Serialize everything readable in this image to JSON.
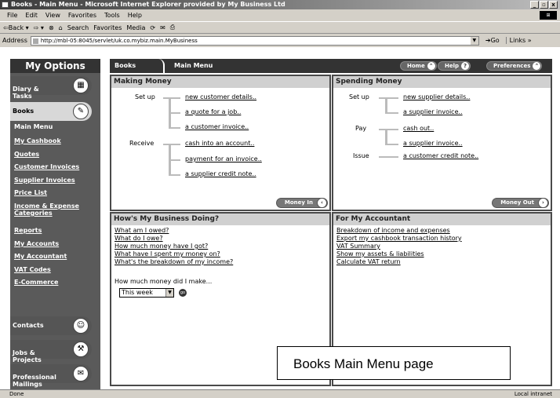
{
  "browser": {
    "title": "Books - Main Menu - Microsoft Internet Explorer provided by My Business Ltd",
    "menu": [
      "File",
      "Edit",
      "View",
      "Favorites",
      "Tools",
      "Help"
    ],
    "toolbar": [
      "⇦Back ▾",
      "⇨ ▾",
      "⊗",
      "⌂",
      "Search",
      "Favorites",
      "Media",
      "",
      "",
      ""
    ],
    "address_label": "Address",
    "address_value": "http://mbl-05:8045/servlet/uk.co.mybiz.main.MyBusiness",
    "go_label": "Go",
    "links_label": "Links",
    "status_left": "Done",
    "status_right": "Local intranet"
  },
  "sidebar": {
    "header": "My Options",
    "diary_label": "Diary &\nTasks",
    "books_label": "Books",
    "main_menu_label": "Main Menu",
    "links": [
      "My Cashbook",
      "Quotes",
      "Customer Invoices",
      "Supplier Invoices",
      "Price List",
      "Income & Expense Categories",
      "Reports",
      "My Accounts",
      "My Accountant",
      "VAT Codes",
      "E-Commerce"
    ],
    "contacts_label": "Contacts",
    "jobs_label": "Jobs &\nProjects",
    "mailings_label": "Professional\nMailings"
  },
  "topnav": {
    "tab_books": "Books",
    "tab_main_menu": "Main Menu",
    "home": "Home",
    "help": "Help",
    "preferences": "Preferences"
  },
  "making_money": {
    "title": "Making Money",
    "setup_label": "Set up",
    "setup_links": [
      "new customer details..",
      "a quote for a job..",
      "a customer invoice.."
    ],
    "receive_label": "Receive",
    "receive_links": [
      "cash into an account..",
      "payment for an invoice..",
      "a supplier credit note.."
    ],
    "button": "Money In"
  },
  "spending_money": {
    "title": "Spending Money",
    "setup_label": "Set up",
    "setup_links": [
      "new supplier details..",
      "a supplier invoice.."
    ],
    "pay_label": "Pay",
    "pay_links": [
      "cash out..",
      "a supplier invoice.."
    ],
    "issue_label": "Issue",
    "issue_links": [
      "a customer credit note.."
    ],
    "button": "Money Out"
  },
  "business_doing": {
    "title": "How's My Business Doing?",
    "questions": [
      "What am I owed?",
      "What do I owe?",
      "How much money have I got?",
      "What have I spent my money on?",
      "What's the breakdown of my income?"
    ],
    "prompt": "How much money did I make...",
    "period": "This week"
  },
  "accountant": {
    "title": "For My Accountant",
    "links": [
      "Breakdown of income and expenses",
      "Export my cashbook transaction history",
      "VAT Summary",
      "Show my assets & liabilities",
      "Calculate VAT return"
    ]
  },
  "caption": "Books Main Menu page"
}
